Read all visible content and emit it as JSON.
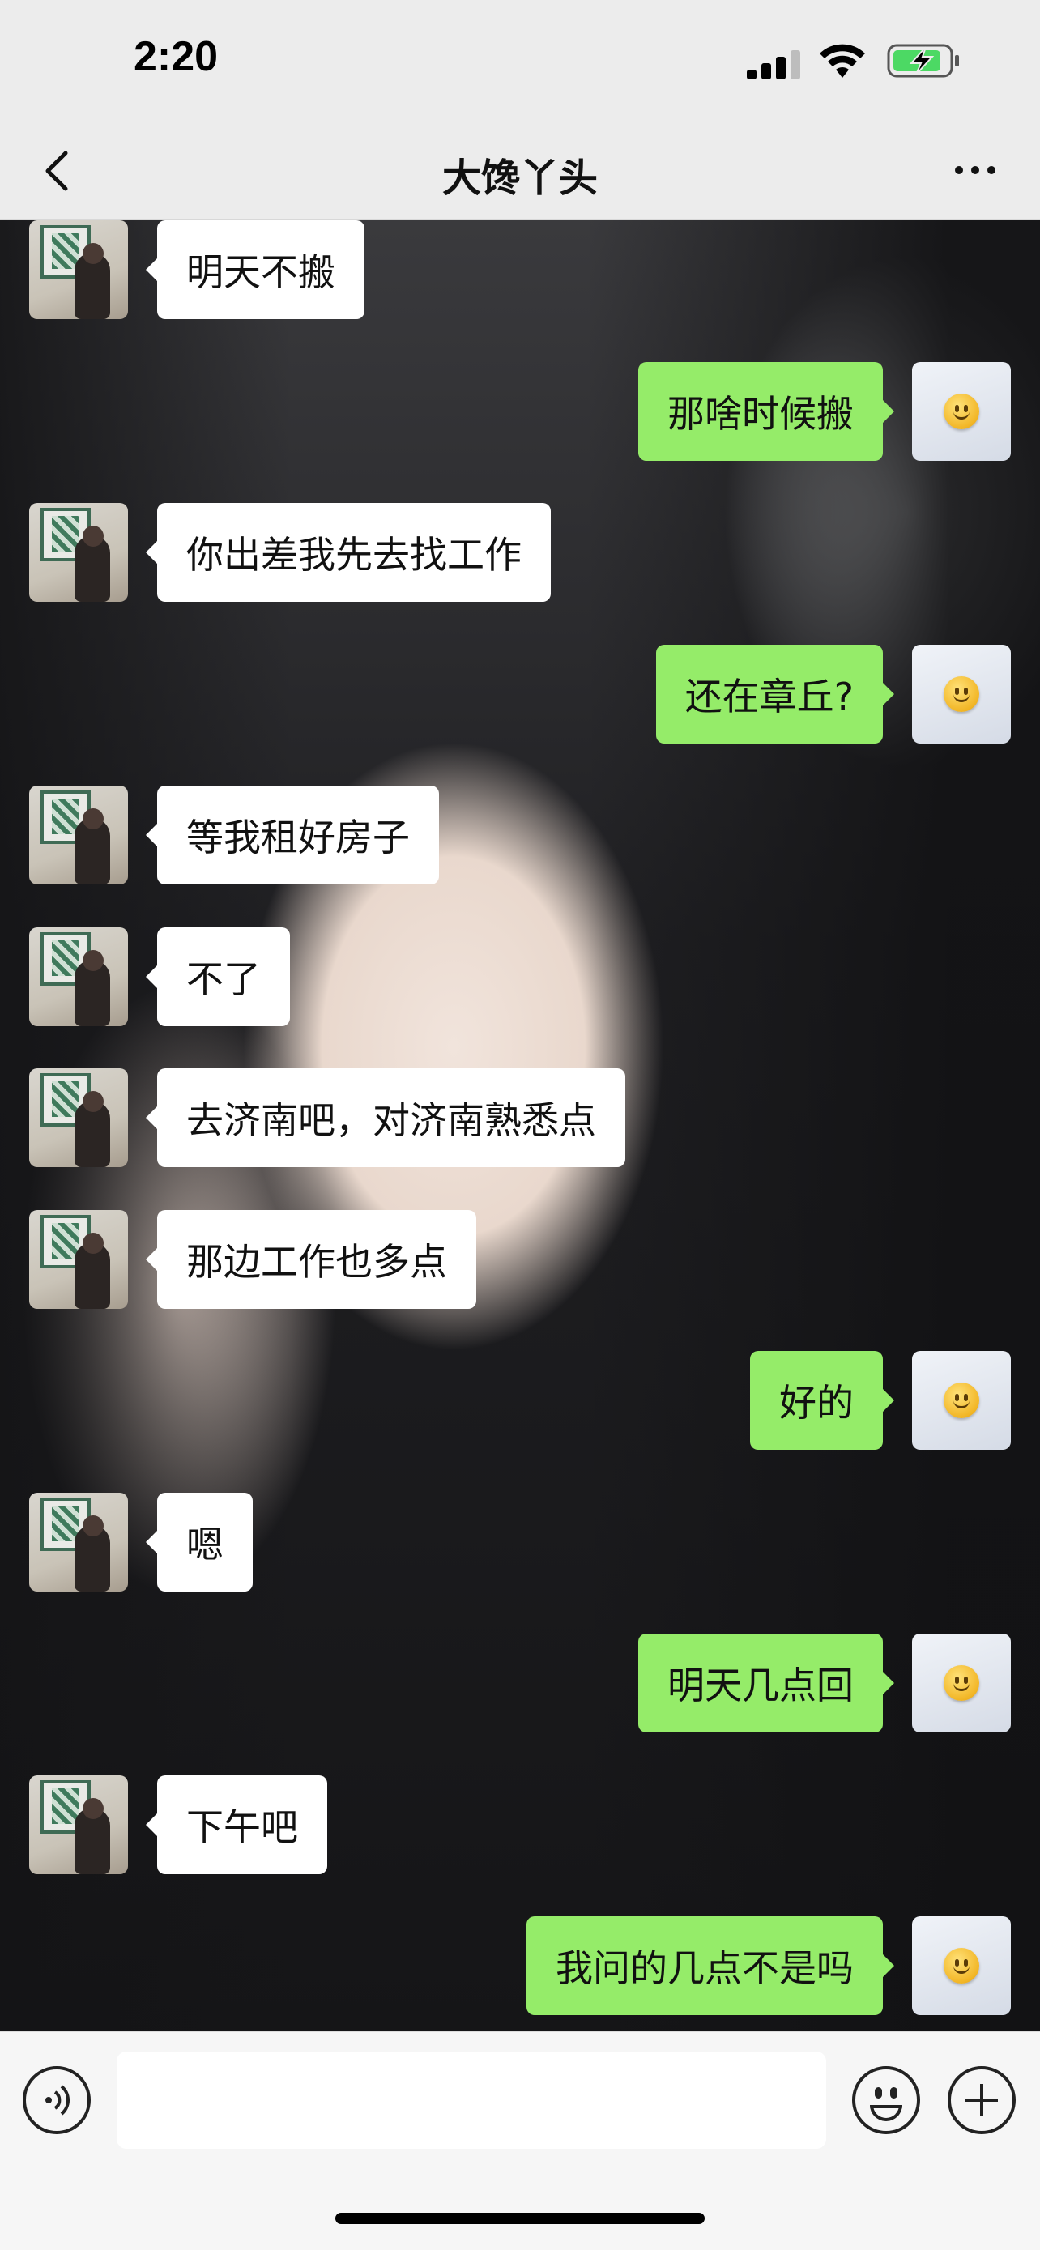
{
  "status_bar": {
    "time": "2:20"
  },
  "header": {
    "title": "大馋丫头",
    "back_icon": "chevron-left-icon",
    "more_icon": "more-dots-icon"
  },
  "messages": [
    {
      "side": "left",
      "text": "明天不搬"
    },
    {
      "side": "right",
      "text": "那啥时候搬"
    },
    {
      "side": "left",
      "text": "你出差我先去找工作"
    },
    {
      "side": "right",
      "text": "还在章丘?"
    },
    {
      "side": "left",
      "text": "等我租好房子"
    },
    {
      "side": "left",
      "text": "不了"
    },
    {
      "side": "left",
      "text": "去济南吧，对济南熟悉点"
    },
    {
      "side": "left",
      "text": "那边工作也多点"
    },
    {
      "side": "right",
      "text": "好的"
    },
    {
      "side": "left",
      "text": "嗯"
    },
    {
      "side": "right",
      "text": "明天几点回"
    },
    {
      "side": "left",
      "text": "下午吧"
    },
    {
      "side": "right",
      "text": "我问的几点不是吗"
    }
  ],
  "input_bar": {
    "value": "",
    "voice_icon": "voice-icon",
    "emoji_icon": "emoji-icon",
    "plus_icon": "plus-icon"
  },
  "colors": {
    "sent_bubble": "#95ec69",
    "received_bubble": "#ffffff",
    "bar_background": "#ececec"
  }
}
